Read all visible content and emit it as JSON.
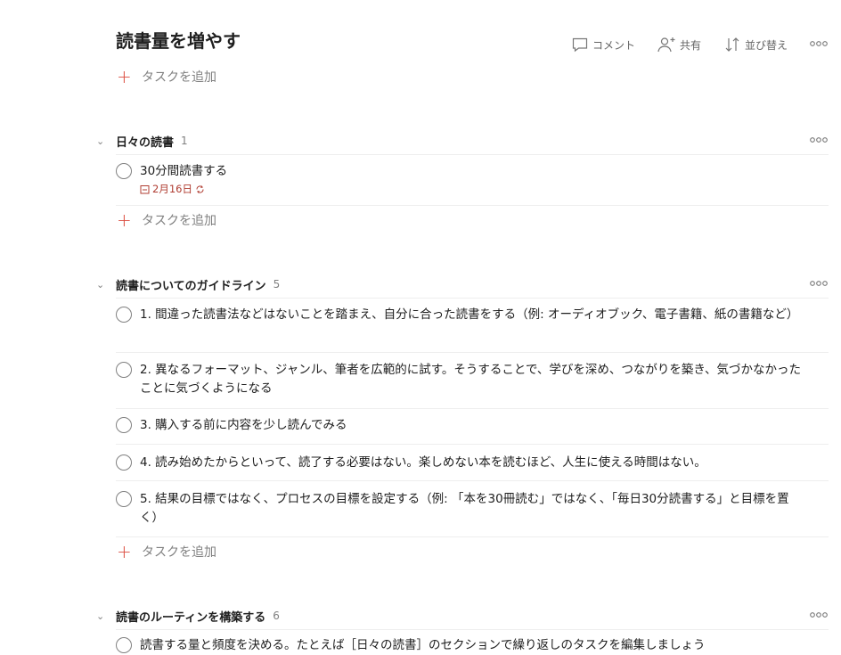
{
  "header": {
    "title": "読書量を増やす",
    "comment_label": "コメント",
    "share_label": "共有",
    "sort_label": "並び替え"
  },
  "add_task_label": "タスクを追加",
  "sections": [
    {
      "title": "日々の読書",
      "count": "1",
      "tasks": [
        {
          "text": "30分間読書する",
          "due": "2月16日",
          "recurring": true
        }
      ]
    },
    {
      "title": "読書についてのガイドライン",
      "count": "5",
      "tasks": [
        {
          "text": "1. 間違った読書法などはないことを踏まえ、自分に合った読書をする（例: オーディオブック、電子書籍、紙の書籍など）"
        },
        {
          "text": "2. 異なるフォーマット、ジャンル、筆者を広範的に試す。そうすることで、学びを深め、つながりを築き、気づかなかったことに気づくようになる"
        },
        {
          "text": "3. 購入する前に内容を少し読んでみる"
        },
        {
          "text": "4. 読み始めたからといって、読了する必要はない。楽しめない本を読むほど、人生に使える時間はない。"
        },
        {
          "text": "5. 結果の目標ではなく、プロセスの目標を設定する（例: 「本を30冊読む」ではなく、「毎日30分読書する」と目標を置く）"
        }
      ]
    },
    {
      "title": "読書のルーティンを構築する",
      "count": "6",
      "tasks": [
        {
          "text": "読書する量と頻度を決める。たとえば［日々の読書］のセクションで繰り返しのタスクを編集しましょう"
        }
      ]
    }
  ],
  "colors": {
    "accent": "#db4c3f",
    "due": "#b03d32",
    "muted": "#808080"
  }
}
